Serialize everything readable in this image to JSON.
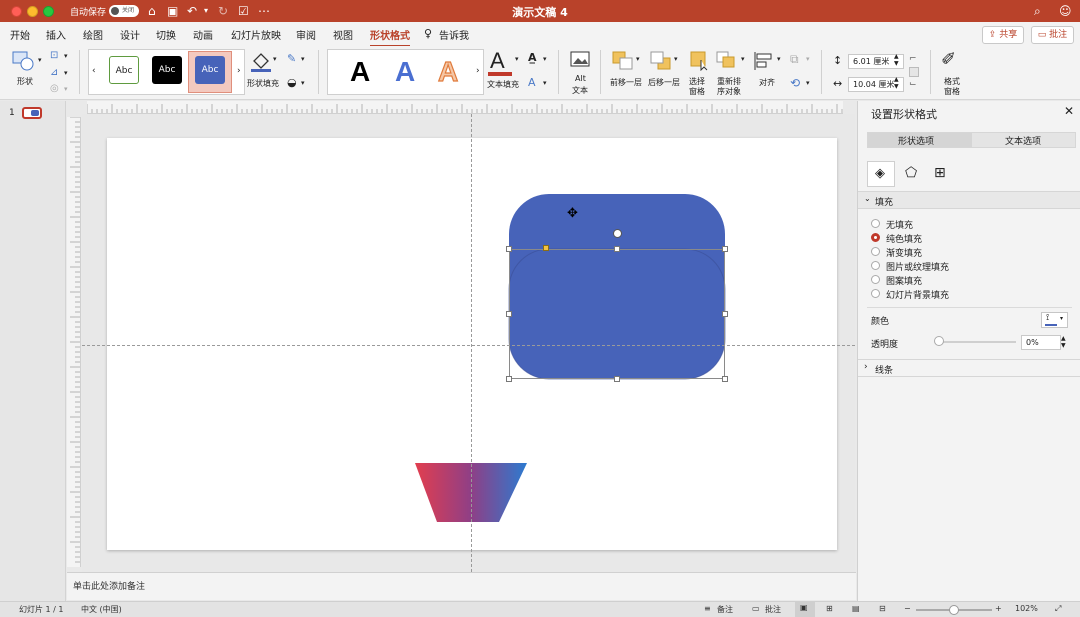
{
  "window": {
    "title": "演示文稿 4",
    "autosave_label": "自动保存",
    "autosave_state": "关闭"
  },
  "menu": {
    "items": [
      "开始",
      "插入",
      "绘图",
      "设计",
      "切换",
      "动画",
      "幻灯片放映",
      "审阅",
      "视图",
      "形状格式"
    ],
    "active": "形状格式",
    "tell_me": "告诉我",
    "share": "共享",
    "comment": "批注"
  },
  "ribbon": {
    "shape_label": "形状",
    "style_samples": [
      "Abc",
      "Abc",
      "Abc"
    ],
    "shape_fill": "形状填充",
    "wordart_letters": [
      "A",
      "A",
      "A"
    ],
    "text_fill": "文本填充",
    "alt_text": [
      "Alt",
      "文本"
    ],
    "bring_forward": "前移一层",
    "send_backward": "后移一层",
    "selection_pane": [
      "选择",
      "窗格"
    ],
    "reorder": [
      "重新排",
      "序对象"
    ],
    "align": "对齐",
    "height_value": "6.01 厘米",
    "width_value": "10.04 厘米",
    "format_pane": [
      "格式",
      "窗格"
    ]
  },
  "thumbs": {
    "number": "1"
  },
  "notes": {
    "placeholder": "单击此处添加备注"
  },
  "status": {
    "slide": "幻灯片 1 / 1",
    "language": "中文 (中国)",
    "notes": "备注",
    "comments": "批注",
    "zoom": "102%"
  },
  "panel": {
    "title": "设置形状格式",
    "tabs": [
      "形状选项",
      "文本选项"
    ],
    "fill_header": "填充",
    "fill_options": [
      "无填充",
      "纯色填充",
      "渐变填充",
      "图片或纹理填充",
      "图案填充",
      "幻灯片背景填充"
    ],
    "selected_fill": "纯色填充",
    "color_label": "颜色",
    "transparency_label": "透明度",
    "transparency_value": "0%",
    "line_header": "线条"
  },
  "colors": {
    "accent": "#b9422a",
    "shape_blue": "#4763b9",
    "gradient_left": "#e23e4f",
    "gradient_right": "#2c7bd0"
  }
}
